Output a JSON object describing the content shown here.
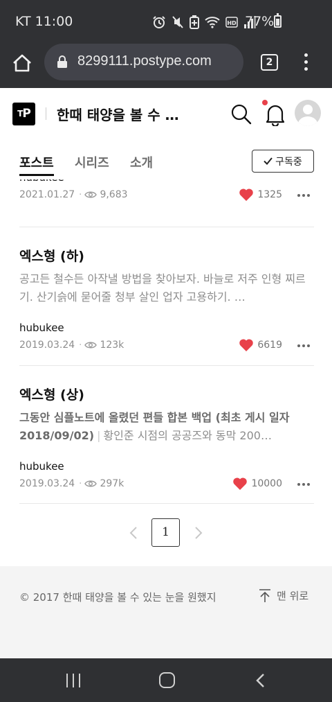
{
  "status_bar": {
    "carrier_time": "KT 11:00",
    "battery": "77%",
    "icons": [
      "alarm-icon",
      "mute-icon",
      "battery-saver-icon",
      "wifi-icon",
      "hd-voice-icon",
      "signal-icon",
      "battery-icon"
    ]
  },
  "browser": {
    "url": "8299111.postype.com",
    "tab_count": "2"
  },
  "header": {
    "logo": "P",
    "blog_title": "한때 태양을 볼 수 …",
    "has_notification": true
  },
  "tabs": {
    "items": [
      {
        "label": "포스트",
        "active": true
      },
      {
        "label": "시리즈",
        "active": false
      },
      {
        "label": "소개",
        "active": false
      }
    ],
    "subscribe_label": "구독중"
  },
  "posts": [
    {
      "author": "hubukee",
      "date": "2021.01.27",
      "views": "9,683",
      "likes": "1325"
    },
    {
      "title": "엑스형 (하)",
      "excerpt": "공고든 철수든 아작낼 방법을 찾아보자. 바늘로 저주 인형 찌르기. 산기슭에 묻어줄 청부 살인 업자 고용하기. …",
      "author": "hubukee",
      "date": "2019.03.24",
      "views": "123k",
      "likes": "6619"
    },
    {
      "title": "엑스형 (상)",
      "excerpt_bold": "그동안 심플노트에 올렸던 편들 합본 백업 (최초 게시 일자 2018/09/02)",
      "excerpt": "황인준 시점의 공공즈와 동막 200…",
      "author": "hubukee",
      "date": "2019.03.24",
      "views": "297k",
      "likes": "10000"
    }
  ],
  "pagination": {
    "current_page": "1"
  },
  "footer": {
    "copyright": "© 2017 한때 태양을 볼 수 있는 눈을 원했지",
    "to_top": "맨 위로"
  },
  "colors": {
    "chrome_bg": "#303134",
    "url_bar_bg": "#42434a",
    "like_heart": "#e8414a",
    "notification_dot": "#e8414a",
    "footer_bg": "#f4f4f4",
    "system_nav_bg": "#2f3033"
  }
}
